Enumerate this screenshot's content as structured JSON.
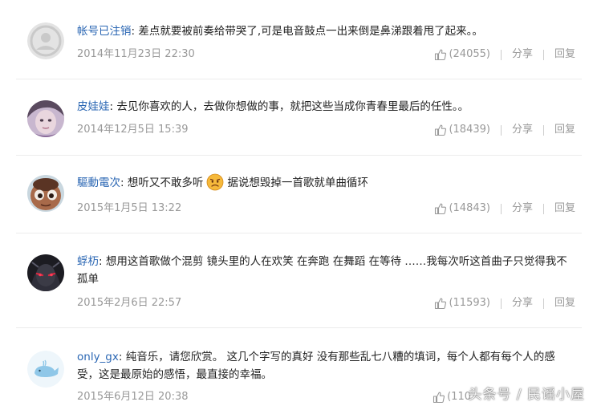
{
  "comments": [
    {
      "username": "帐号已注销",
      "sep": ": ",
      "text": "差点就要被前奏给带哭了,可是电音鼓点一出来倒是鼻涕跟着甩了起来。。",
      "time": "2014年11月23日 22:30",
      "likes": "(24055)",
      "share": "分享",
      "reply": "回复"
    },
    {
      "username": "皮娃娃",
      "sep": ": ",
      "text": "去见你喜欢的人，去做你想做的事，就把这些当成你青春里最后的任性。。",
      "time": "2014年12月5日 15:39",
      "likes": "(18439)",
      "share": "分享",
      "reply": "回复"
    },
    {
      "username": "驅動電次",
      "sep": ": ",
      "text_before": "想听又不敢多听",
      "text_after": "据说想毁掉一首歌就单曲循环",
      "time": "2015年1月5日 13:22",
      "likes": "(14843)",
      "share": "分享",
      "reply": "回复"
    },
    {
      "username": "蜉杤",
      "sep": ": ",
      "text": "想用这首歌做个混剪 镜头里的人在欢笑 在奔跑 在舞蹈 在等待 ……我每次听这首曲子只觉得我不孤单",
      "time": "2015年2月6日 22:57",
      "likes": "(11593)",
      "share": "分享",
      "reply": "回复"
    },
    {
      "username": "only_gx",
      "sep": ": ",
      "text": "纯音乐，请您欣赏。 这几个字写的真好 没有那些乱七八糟的填词，每个人都有每个人的感受，这是最原始的感悟，最直接的幸福。",
      "time": "2015年6月12日 20:38",
      "likes": "(110",
      "share": "分享",
      "reply": "回复"
    }
  ],
  "watermark": "头条号 / 民谣小屋",
  "icons": {
    "like": "thumbs-up-icon",
    "emoji": "worried-face-icon"
  },
  "colors": {
    "username": "#2a66b3",
    "meta": "#999999",
    "text": "#222222"
  }
}
